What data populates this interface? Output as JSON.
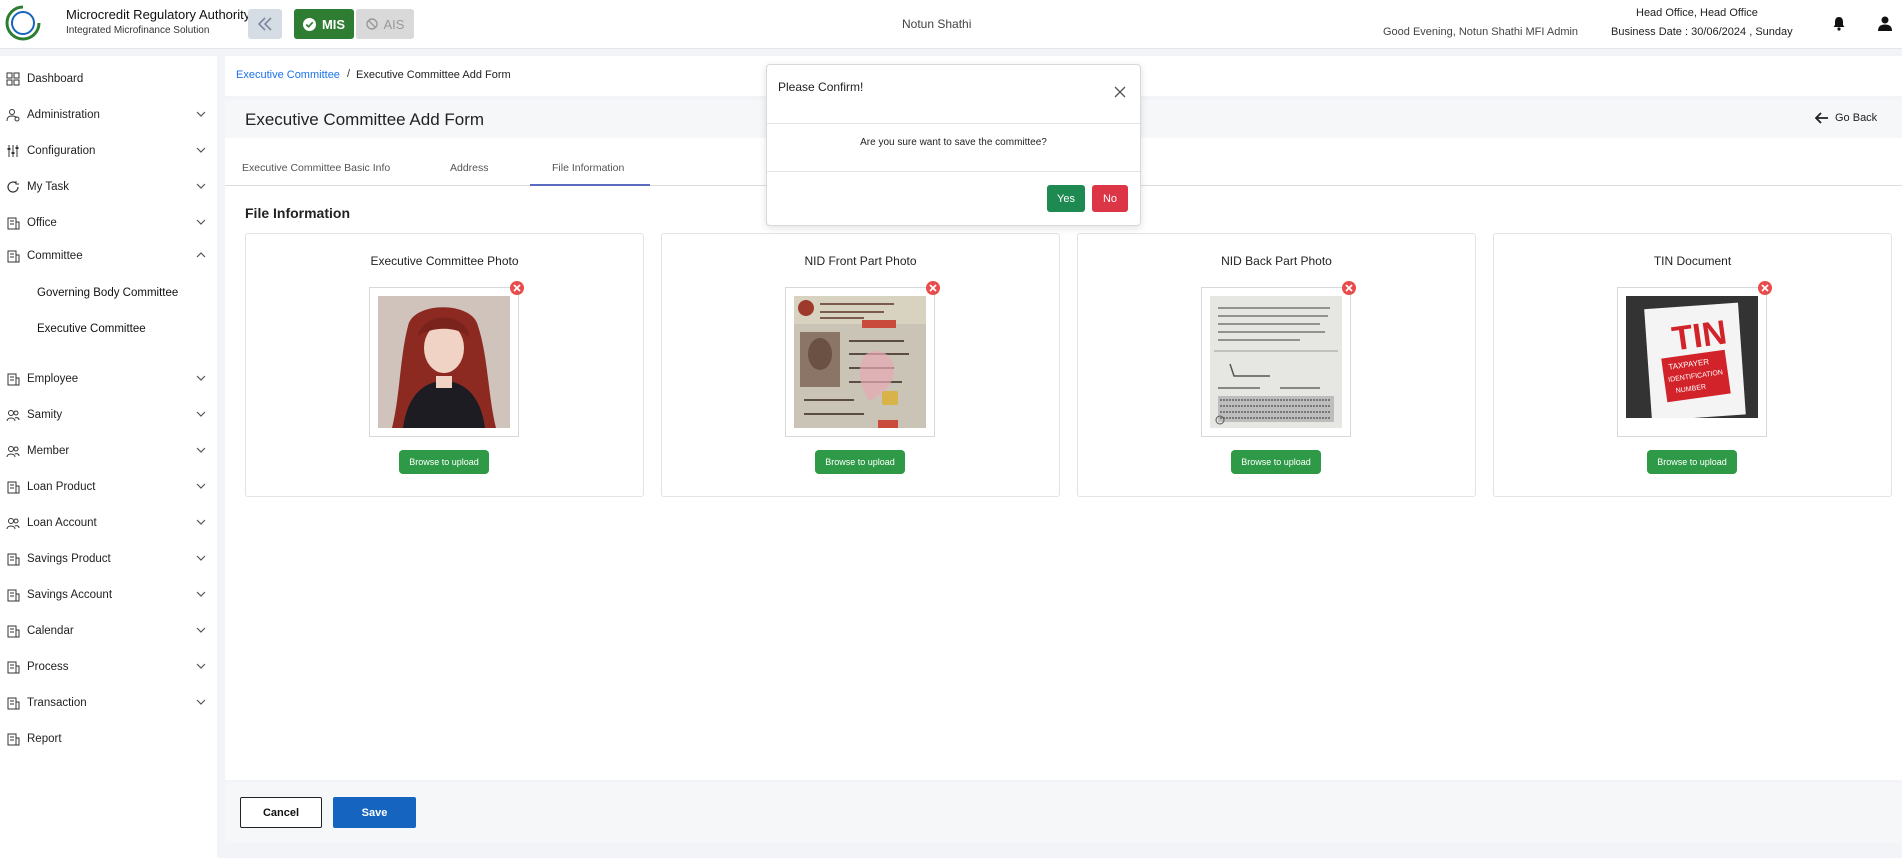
{
  "header": {
    "logo_text": "Microcredit Regulatory Authority",
    "app_title": "Microcredit Regulatory Authority",
    "app_subtitle": "Integrated Microfinance Solution",
    "mis_label": "MIS",
    "ais_label": "AIS",
    "org_name": "Notun Shathi",
    "greeting": "Good Evening, Notun Shathi MFI Admin",
    "office": "Head Office, Head Office",
    "business_date": "Business Date : 30/06/2024 , Sunday"
  },
  "sidebar": {
    "items": [
      {
        "label": "Dashboard",
        "icon": "grid-icon"
      },
      {
        "label": "Administration",
        "icon": "user-gear-icon"
      },
      {
        "label": "Configuration",
        "icon": "sliders-icon"
      },
      {
        "label": "My Task",
        "icon": "refresh-icon"
      },
      {
        "label": "Office",
        "icon": "building-icon"
      },
      {
        "label": "Committee",
        "icon": "building-icon"
      },
      {
        "label": "Employee",
        "icon": "building-icon"
      },
      {
        "label": "Samity",
        "icon": "people-icon"
      },
      {
        "label": "Member",
        "icon": "people-icon"
      },
      {
        "label": "Loan Product",
        "icon": "building-icon"
      },
      {
        "label": "Loan Account",
        "icon": "people-icon"
      },
      {
        "label": "Savings Product",
        "icon": "building-icon"
      },
      {
        "label": "Savings Account",
        "icon": "building-icon"
      },
      {
        "label": "Calendar",
        "icon": "building-icon"
      },
      {
        "label": "Process",
        "icon": "building-icon"
      },
      {
        "label": "Transaction",
        "icon": "building-icon"
      },
      {
        "label": "Report",
        "icon": "building-icon"
      }
    ],
    "committee_sub": [
      "Governing Body Committee",
      "Executive Committee"
    ]
  },
  "breadcrumb": {
    "parent": "Executive Committee",
    "separator": "/",
    "current": "Executive Committee Add Form"
  },
  "page": {
    "title": "Executive Committee Add Form",
    "go_back": "Go Back",
    "tabs": [
      "Executive Committee Basic Info",
      "Address",
      "File Information"
    ],
    "active_tab": "File Information",
    "section_title": "File Information"
  },
  "cards": [
    {
      "title": "Executive Committee Photo",
      "upload_label": "Browse to upload"
    },
    {
      "title": "NID Front Part Photo",
      "upload_label": "Browse to upload"
    },
    {
      "title": "NID Back Part Photo",
      "upload_label": "Browse to upload"
    },
    {
      "title": "TIN Document",
      "upload_label": "Browse to upload"
    }
  ],
  "tin_image": {
    "big": "TIN",
    "line1": "TAXPAYER",
    "line2": "IDENTIFICATION",
    "line3": "NUMBER"
  },
  "footer": {
    "cancel": "Cancel",
    "save": "Save"
  },
  "modal": {
    "title": "Please Confirm!",
    "message": "Are you sure want to save the committee?",
    "yes": "Yes",
    "no": "No"
  },
  "colors": {
    "primary": "#1565c0",
    "success": "#2e9a47",
    "danger": "#dc3545",
    "mis_green": "#2e7d32"
  }
}
